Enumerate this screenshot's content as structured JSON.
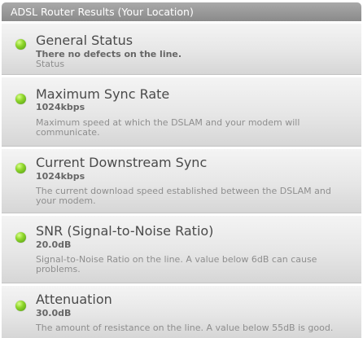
{
  "header": {
    "title": "ADSL Router Results (Your Location)"
  },
  "rows": [
    {
      "title": "General Status",
      "value": "There no defects on the line.",
      "description": "Status",
      "status_icon": "green-status-dot"
    },
    {
      "title": "Maximum Sync Rate",
      "value": "1024kbps",
      "description": "Maximum speed at which the DSLAM and your modem will communicate.",
      "status_icon": "green-status-dot"
    },
    {
      "title": "Current Downstream Sync",
      "value": "1024kbps",
      "description": "The current download speed established between the DSLAM and your modem.",
      "status_icon": "green-status-dot"
    },
    {
      "title": "SNR (Signal-to-Noise Ratio)",
      "value": "20.0dB",
      "description": "Signal-to-Noise Ratio on the line. A value below 6dB can cause problems.",
      "status_icon": "green-status-dot"
    },
    {
      "title": "Attenuation",
      "value": "30.0dB",
      "description": "The amount of resistance on the line. A value below 55dB is good.",
      "status_icon": "green-status-dot"
    }
  ],
  "colors": {
    "header_background": "#999999",
    "status_ok": "#7cc61e"
  }
}
